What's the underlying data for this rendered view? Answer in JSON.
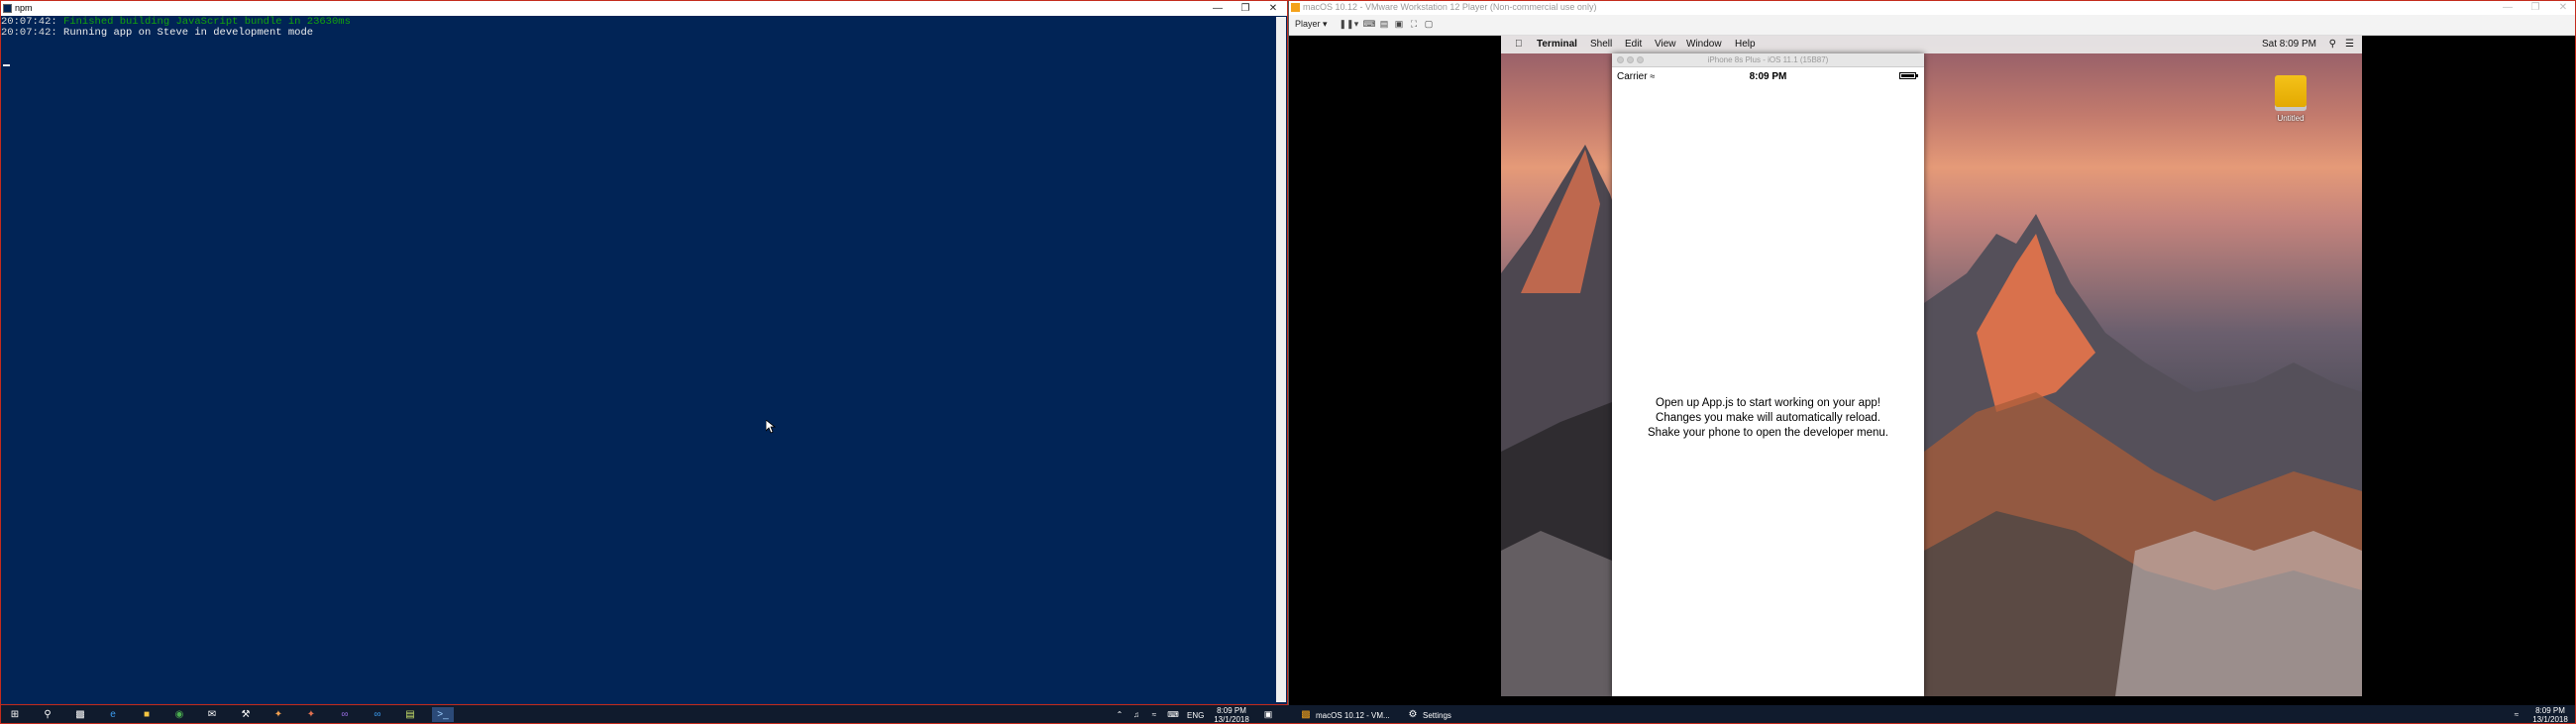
{
  "terminal": {
    "title": "npm",
    "lines": [
      {
        "time": "20:07:42:",
        "text": "Finished building JavaScript bundle in 23630ms",
        "color": "#13a10e"
      },
      {
        "time": "20:07:42:",
        "text": "Running app on Steve in development mode",
        "color": "#eeeeee"
      }
    ],
    "background": "#012456"
  },
  "vmware": {
    "title": "macOS 10.12 - VMware Workstation 12 Player (Non-commercial use only)",
    "player_menu": "Player ▾"
  },
  "mac": {
    "menubar": {
      "apple": "",
      "app": "Terminal",
      "items": [
        "Shell",
        "Edit",
        "View",
        "Window",
        "Help"
      ],
      "clock": "Sat 8:09 PM"
    },
    "desktop_icon_label": "Untitled"
  },
  "simulator": {
    "title": "iPhone 8s Plus - iOS 11.1 (15B87)",
    "carrier": "Carrier",
    "time": "8:09 PM",
    "battery_level": 1.0,
    "message_lines": [
      "Open up App.js to start working on your app!",
      "Changes you make will automatically reload.",
      "Shake your phone to open the developer menu."
    ]
  },
  "taskbar_left": {
    "lang": "ENG",
    "time": "8:09 PM",
    "date": "13/1/2018"
  },
  "taskbar_right": {
    "vm_task": "macOS 10.12 - VM...",
    "settings_task": "Settings",
    "time": "8:09 PM",
    "date": "13/1/2018"
  }
}
